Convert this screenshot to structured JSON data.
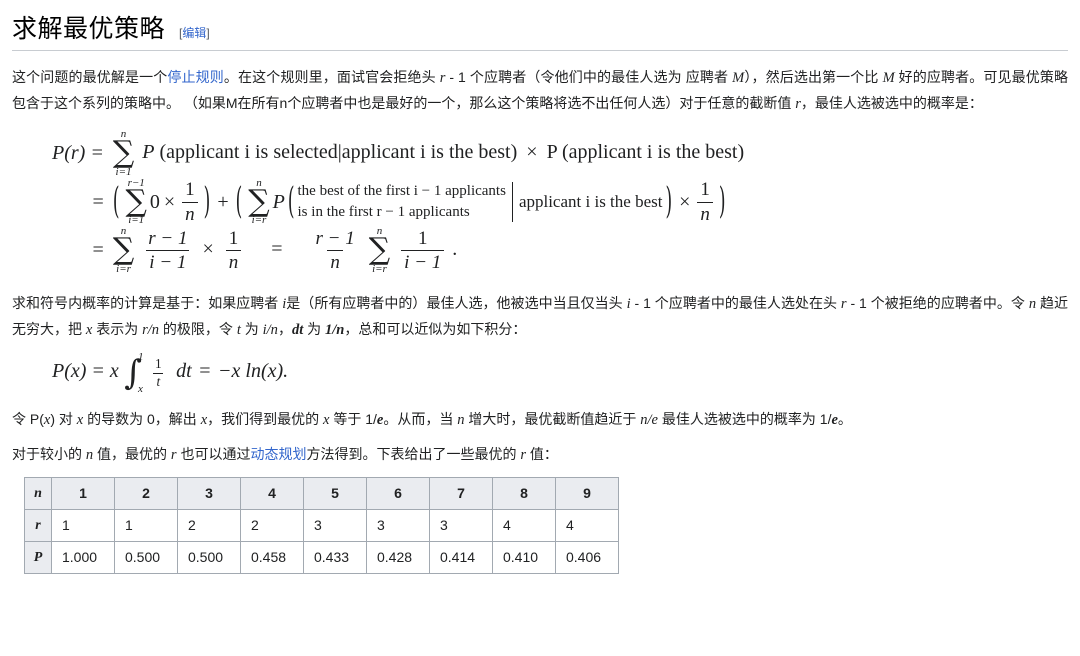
{
  "heading": {
    "title": "求解最优策略",
    "edit_open_bracket": "[",
    "edit_label": "编辑",
    "edit_close_bracket": "]"
  },
  "paragraph1": {
    "seg1": "这个问题的最优解是一个",
    "link1": "停止规则",
    "seg2": "。在这个规则里，面试官会拒绝头 ",
    "var_r_1": "r",
    "seg3": " - 1 个应聘者（令他们中的最佳人选为 应聘者 ",
    "var_M_1": "M",
    "seg4": "），然后选出第一个比 ",
    "var_M_2": "M",
    "seg5": " 好的应聘者。可见最优策略包含于这个系列的策略中。 （如果M在所有n个应聘者中也是最好的一个，那么这个策略将选不出任何人选）对于任意的截断值 ",
    "var_r_2": "r",
    "seg6": "，最佳人选被选中的概率是："
  },
  "formula1": {
    "lhs_row1": "P(r) =",
    "lhs_row2": "=",
    "lhs_row3": "=",
    "sum_top_1": "n",
    "sum_bot_1": "i=1",
    "p_symbol": "P",
    "cond_selected": "applicant i is selected",
    "cond_best": "applicant i is the best",
    "times": "×",
    "prob_best": "P (applicant i is the best)",
    "sum2_top": "r−1",
    "sum2_bot": "i=1",
    "zero": "0",
    "frac_one": "1",
    "frac_n": "n",
    "plus": "+",
    "sum3_top": "n",
    "sum3_bot": "i=r",
    "case_line1": "the best of the first i − 1 applicants",
    "case_line2": "is in the first r − 1 applicants",
    "given_best": "applicant i is the best",
    "sum4_top": "n",
    "sum4_bot": "i=r",
    "frac_rm1_num": "r − 1",
    "frac_im1_den": "i − 1",
    "equals": "=",
    "frac_rm1_num_b": "r − 1",
    "frac_n_den_b": "n",
    "sum5_top": "n",
    "sum5_bot": "i=r",
    "frac_one_b": "1",
    "frac_im1_b": "i − 1",
    "period": "."
  },
  "paragraph2": {
    "seg1": "求和符号内概率的计算是基于：如果应聘者 ",
    "var_i_1": "i",
    "seg2": "是（所有应聘者中的）最佳人选，他被选中当且仅当头 ",
    "var_i_2": "i",
    "seg3": " - 1 个应聘者中的最佳人选处在头 ",
    "var_r_1": "r",
    "seg4": " - 1 个被拒绝的应聘者中。令 ",
    "var_n_1": "n",
    "seg5": " 趋近无穷大，把 ",
    "var_x_1": "x",
    "seg6": " 表示为 ",
    "var_rn": "r/n",
    "seg7": " 的极限，令 ",
    "var_t": "t",
    "seg8": " 为 ",
    "var_in": "i/n",
    "seg9": "，",
    "var_dt": "dt",
    "seg10": " 为 ",
    "var_1n": "1/n",
    "seg11": "，总和可以近似为如下积分："
  },
  "formula2": {
    "lhs": "P(x) = x",
    "int_top": "1",
    "int_bot": "x",
    "frac_num": "1",
    "frac_den": "t",
    "dt": "dt",
    "equals": "=",
    "rhs": "−x ln(x)."
  },
  "paragraph3": {
    "seg1": "令 P(",
    "var_x_1": "x",
    "seg2": ") 对 ",
    "var_x_2": "x",
    "seg3": " 的导数为 0，解出 ",
    "var_x_3": "x",
    "seg4": "，我们得到最优的 ",
    "var_x_4": "x",
    "seg5": " 等于 1/",
    "var_e_1": "e",
    "seg6": "。从而，当 ",
    "var_n_1": "n",
    "seg7": " 增大时，最优截断值趋近于 ",
    "var_ne": "n/e",
    "seg8": " 最佳人选被选中的概率为 1/",
    "var_e_2": "e",
    "seg9": "。"
  },
  "paragraph4": {
    "seg1": "对于较小的 ",
    "var_n_1": "n",
    "seg2": " 值，最优的 ",
    "var_r_1": "r",
    "seg3": " 也可以通过",
    "link1": "动态规划",
    "seg4": "方法得到。下表给出了一些最优的 ",
    "var_r_2": "r",
    "seg5": " 值："
  },
  "table": {
    "row_labels": [
      "n",
      "r",
      "P"
    ],
    "n_values": [
      "1",
      "2",
      "3",
      "4",
      "5",
      "6",
      "7",
      "8",
      "9"
    ],
    "r_values": [
      "1",
      "1",
      "2",
      "2",
      "3",
      "3",
      "3",
      "4",
      "4"
    ],
    "p_values": [
      "1.000",
      "0.500",
      "0.500",
      "0.458",
      "0.433",
      "0.428",
      "0.414",
      "0.410",
      "0.406"
    ]
  },
  "colors": {
    "link": "#3366cc",
    "text": "#202122",
    "table_header_bg": "#eaecf0",
    "table_border": "#a2a9b1",
    "heading_rule": "#c8ccd1"
  }
}
